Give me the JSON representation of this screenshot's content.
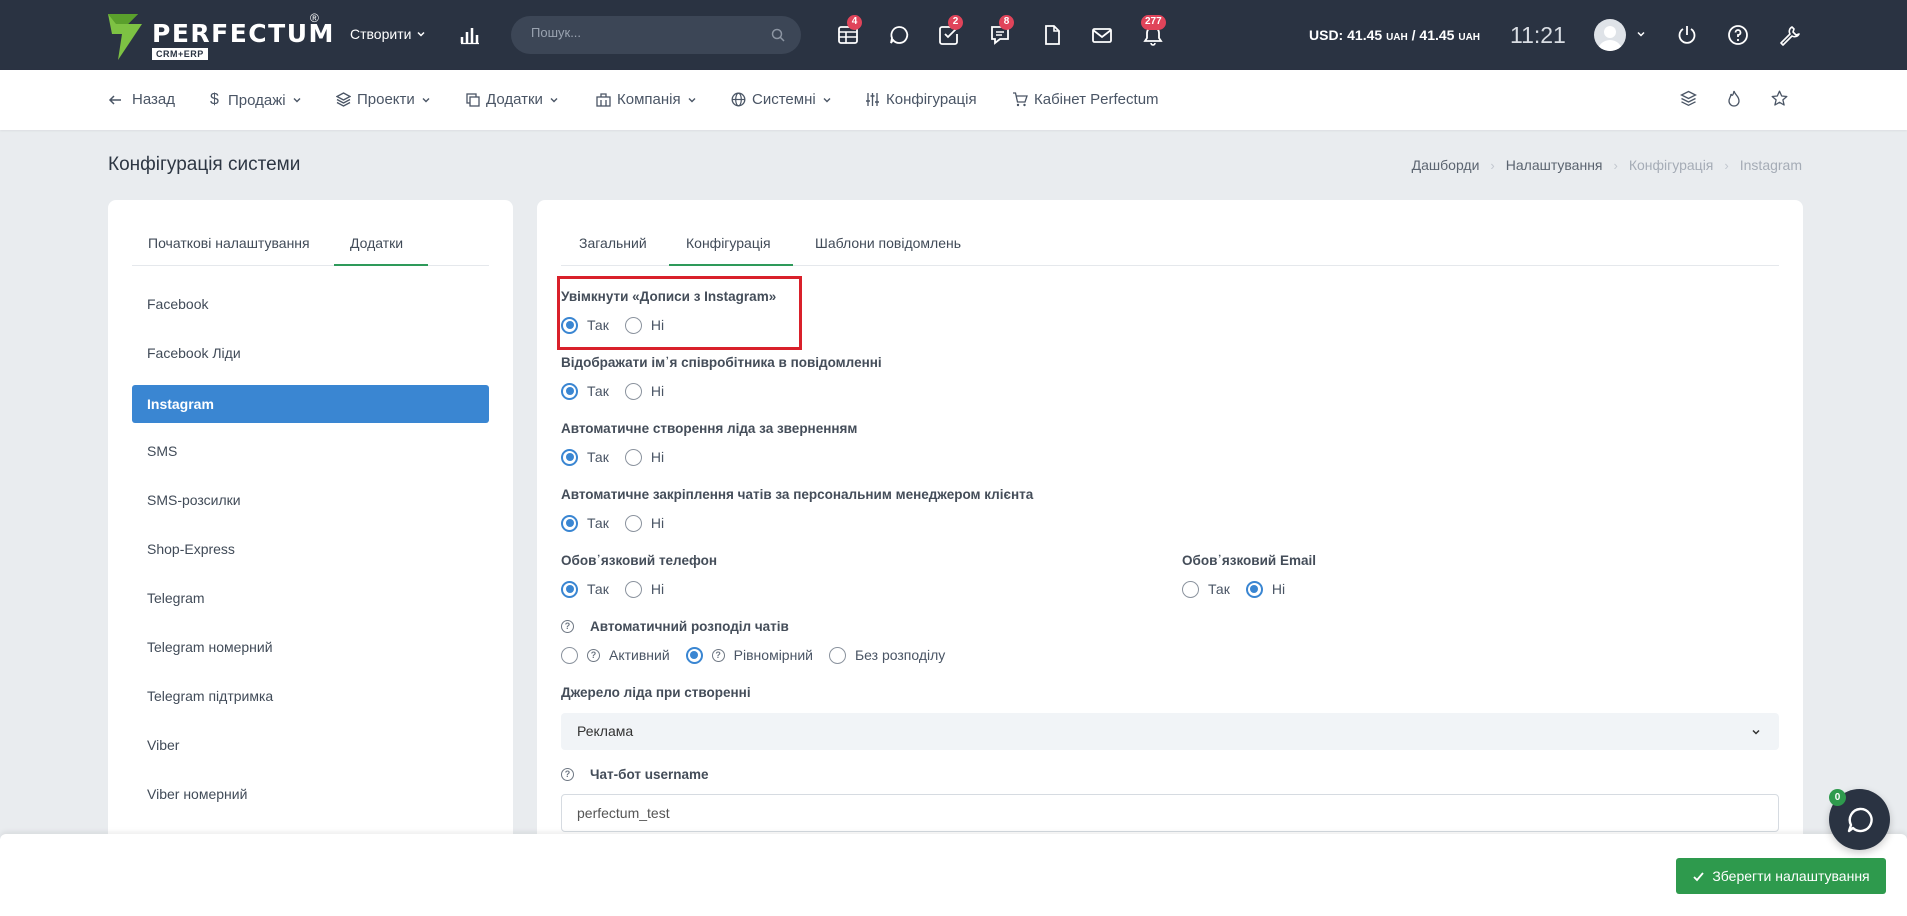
{
  "brand": {
    "name": "PERFECTUM",
    "sub": "CRM+ERP",
    "reg": "®"
  },
  "topbar": {
    "create_label": "Створити",
    "search_placeholder": "Пошук...",
    "badges": {
      "tasks_board": "4",
      "checklist": "2",
      "messages": "8",
      "notifications": "277"
    },
    "currency": {
      "usd_label": "USD:",
      "value1": "41.45",
      "unit1": "UAH",
      "separator": "/",
      "value2": "41.45",
      "unit2": "UAH"
    },
    "time": "11:21"
  },
  "subnav": {
    "items": [
      {
        "label": "Назад"
      },
      {
        "label": "Продажі"
      },
      {
        "label": "Проекти"
      },
      {
        "label": "Додатки"
      },
      {
        "label": "Компанія"
      },
      {
        "label": "Системні"
      },
      {
        "label": "Конфігурація"
      },
      {
        "label": "Кабінет Perfectum"
      }
    ]
  },
  "page": {
    "title": "Конфігурація системи",
    "breadcrumb": [
      "Дашборди",
      "Налаштування",
      "Конфігурація",
      "Instagram"
    ]
  },
  "left": {
    "tabs": [
      "Початкові налаштування",
      "Додатки"
    ],
    "active_tab": "Додатки",
    "items": [
      "Facebook",
      "Facebook Ліди",
      "Instagram",
      "SMS",
      "SMS-розсилки",
      "Shop-Express",
      "Telegram",
      "Telegram номерний",
      "Telegram підтримка",
      "Viber",
      "Viber номерний"
    ],
    "active_item": "Instagram"
  },
  "right": {
    "tabs": [
      "Загальний",
      "Конфігурація",
      "Шаблони повідомлень"
    ],
    "active_tab": "Конфігурація",
    "fields": {
      "enable_posts": {
        "label": "Увімкнути «Дописи з Instagram»",
        "yes": "Так",
        "no": "Ні",
        "value": "Так"
      },
      "show_employee_name": {
        "label": "Відображати ім᾽я співробітника в повідомленні",
        "yes": "Так",
        "no": "Ні",
        "value": "Так"
      },
      "auto_lead": {
        "label": "Автоматичне створення ліда за зверненням",
        "yes": "Так",
        "no": "Ні",
        "value": "Так"
      },
      "auto_assign": {
        "label": "Автоматичне закріплення чатів за персональним менеджером клієнта",
        "yes": "Так",
        "no": "Ні",
        "value": "Так"
      },
      "required_phone": {
        "label": "Обов᾽язковий телефон",
        "yes": "Так",
        "no": "Ні",
        "value": "Так"
      },
      "required_email": {
        "label": "Обов᾽язковий Email",
        "yes": "Так",
        "no": "Ні",
        "value": "Ні"
      },
      "distribution": {
        "label": "Автоматичний розподіл чатів",
        "options": [
          "Активний",
          "Рівномірний",
          "Без розподілу"
        ],
        "value": "Рівномірний"
      },
      "lead_source": {
        "label": "Джерело ліда при створенні",
        "value": "Реклама"
      },
      "bot_username": {
        "label": "Чат-бот username",
        "value": "perfectum_test"
      }
    }
  },
  "footer": {
    "save_label": "Зберегти налаштування"
  },
  "chat": {
    "count": "0"
  },
  "colors": {
    "accent": "#3a86d2",
    "topbar": "#2a3342",
    "save": "#2e9a4d",
    "badge": "#e0445a",
    "highlight": "#d9202a"
  }
}
